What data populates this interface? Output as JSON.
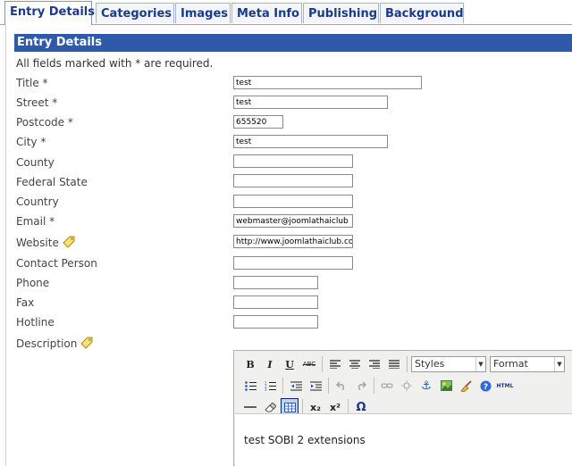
{
  "tabs": [
    {
      "label": "Entry Details"
    },
    {
      "label": "Categories"
    },
    {
      "label": "Images"
    },
    {
      "label": "Meta Info"
    },
    {
      "label": "Publishing"
    },
    {
      "label": "Background"
    }
  ],
  "section": {
    "title": "Entry Details",
    "required_note": "All fields marked with * are required."
  },
  "fields": [
    {
      "label": "Title *",
      "value": ""
    },
    {
      "label": "Street *",
      "value": "test"
    },
    {
      "label": "Postcode *",
      "value": "655520"
    },
    {
      "label": "City *",
      "value": "test"
    },
    {
      "label": "County",
      "value": ""
    },
    {
      "label": "Federal State",
      "value": ""
    },
    {
      "label": "Country",
      "value": ""
    },
    {
      "label": "Email *",
      "value": "webmaster@joomlathaiclub"
    },
    {
      "label": "Website",
      "value": "http://www.joomlathaiclub.com"
    },
    {
      "label": "Contact Person",
      "value": ""
    },
    {
      "label": "Phone",
      "value": ""
    },
    {
      "label": "Fax",
      "value": ""
    },
    {
      "label": "Hotline",
      "value": ""
    }
  ],
  "title_value": "test",
  "description": {
    "label": "Description",
    "content": "test SOBI 2 extensions"
  },
  "editor": {
    "styles_select": "Styles",
    "format_select": "Format",
    "bold": "B",
    "italic": "I",
    "underline": "U",
    "strike": "ABC",
    "html": "HTML",
    "subscript": "x₂",
    "superscript": "x²",
    "special_char": "Ω"
  }
}
